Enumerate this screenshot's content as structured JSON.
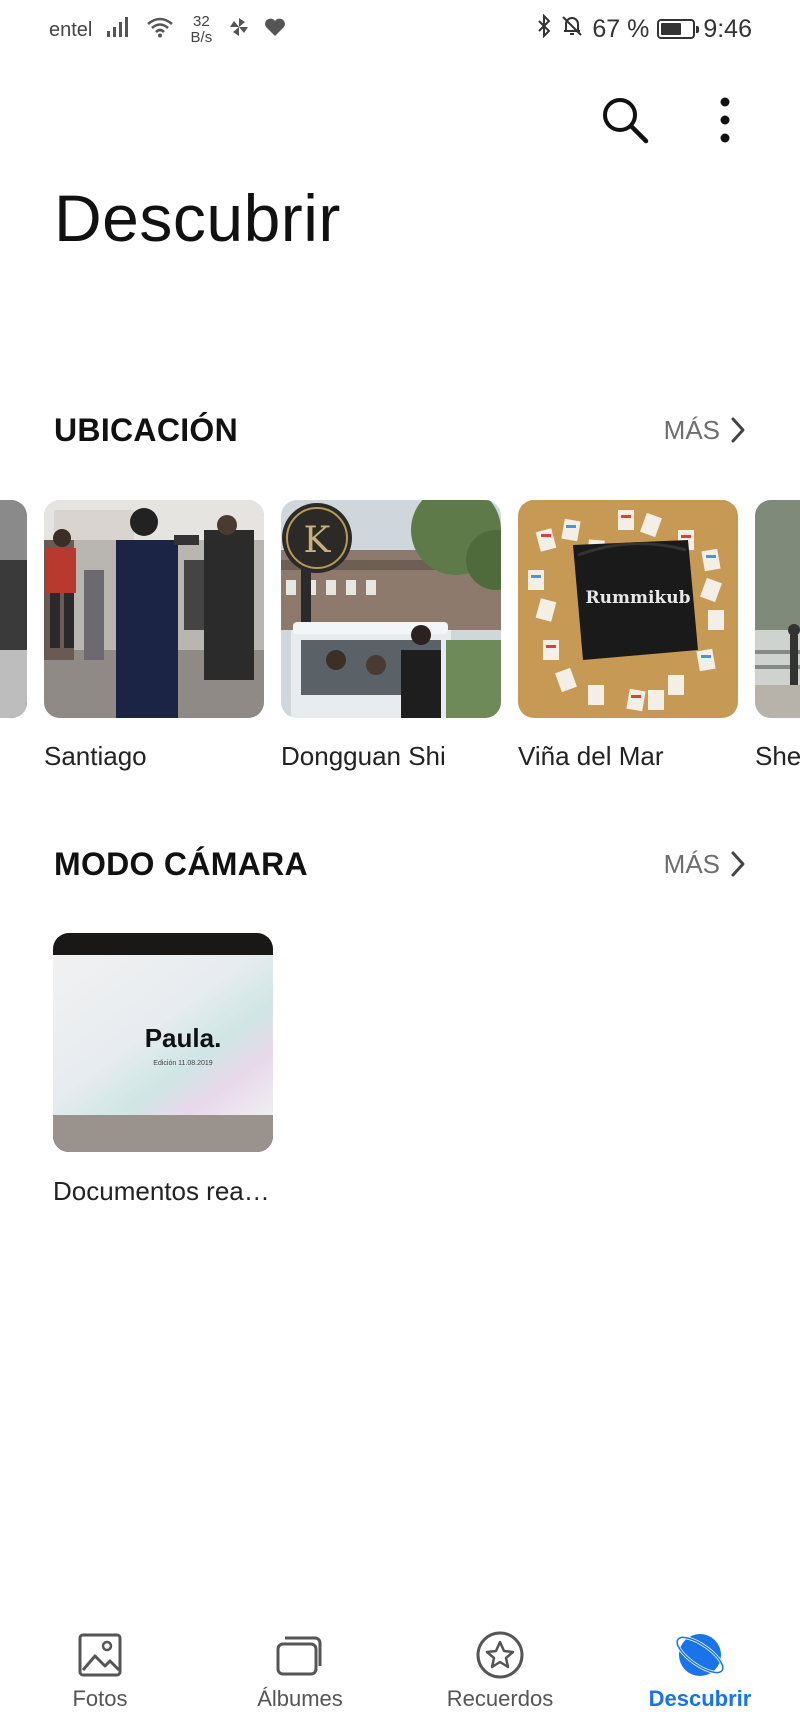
{
  "status_bar": {
    "carrier": "entel",
    "net_speed_value": "32",
    "net_speed_unit": "B/s",
    "battery_text": "67 %",
    "battery_level": 0.67,
    "time": "9:46"
  },
  "header": {
    "search_icon": "search-icon",
    "menu_icon": "more-vertical-icon",
    "title": "Descubrir"
  },
  "location_section": {
    "title": "UBICACIÓN",
    "more_label": "MÁS",
    "places": [
      {
        "label": "Santiago"
      },
      {
        "label": "Dongguan Shi"
      },
      {
        "label": "Viña del Mar"
      },
      {
        "label": "She"
      }
    ]
  },
  "camera_section": {
    "title": "MODO CÁMARA",
    "more_label": "MÁS",
    "items": [
      {
        "label": "Documentos rea…",
        "thumb_title": "Paula.",
        "thumb_caption": "Edición 11.08.2019"
      }
    ]
  },
  "thumb_texts": {
    "dongguan_sign": "K",
    "rummikub_bag": "Rummikub"
  },
  "bottom_nav": {
    "items": [
      {
        "label": "Fotos",
        "icon": "photo-icon"
      },
      {
        "label": "Álbumes",
        "icon": "albums-icon"
      },
      {
        "label": "Recuerdos",
        "icon": "star-circle-icon"
      },
      {
        "label": "Descubrir",
        "icon": "discover-icon",
        "active": true
      }
    ]
  },
  "colors": {
    "accent": "#1a73e8",
    "text": "#111111",
    "muted": "#6e6e6e"
  }
}
